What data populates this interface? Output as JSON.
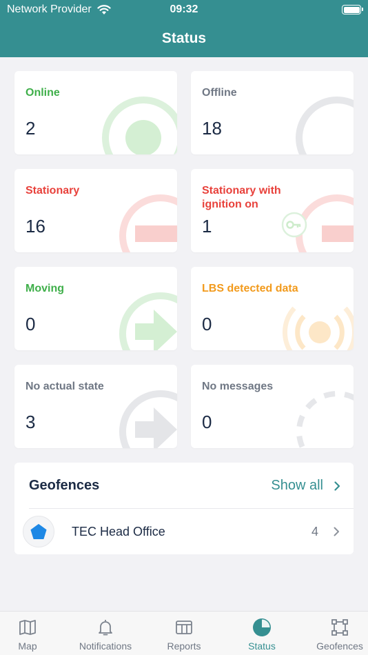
{
  "status_bar": {
    "carrier": "Network Provider",
    "time": "09:32"
  },
  "header": {
    "title": "Status"
  },
  "cards": {
    "online": {
      "label": "Online",
      "count": "2",
      "color": "#3faf4a"
    },
    "offline": {
      "label": "Offline",
      "count": "18",
      "color": "#6f7784"
    },
    "stationary": {
      "label": "Stationary",
      "count": "16",
      "color": "#e8413b"
    },
    "stationary_ignition": {
      "label": "Stationary with ignition on",
      "count": "1",
      "color": "#e8413b"
    },
    "moving": {
      "label": "Moving",
      "count": "0",
      "color": "#3faf4a"
    },
    "lbs": {
      "label": "LBS detected data",
      "count": "0",
      "color": "#f29a1c"
    },
    "no_state": {
      "label": "No actual state",
      "count": "3",
      "color": "#6f7784"
    },
    "no_messages": {
      "label": "No messages",
      "count": "0",
      "color": "#6f7784"
    }
  },
  "geofences": {
    "title": "Geofences",
    "show_all": "Show all",
    "items": [
      {
        "name": "TEC Head Office",
        "count": "4",
        "icon": "pentagon-icon"
      }
    ]
  },
  "tabbar": {
    "tabs": [
      {
        "label": "Map",
        "icon": "map-icon",
        "active": false
      },
      {
        "label": "Notifications",
        "icon": "bell-icon",
        "active": false
      },
      {
        "label": "Reports",
        "icon": "table-icon",
        "active": false
      },
      {
        "label": "Status",
        "icon": "pie-icon",
        "active": true
      },
      {
        "label": "Geofences",
        "icon": "geofence-icon",
        "active": false
      }
    ]
  },
  "colors": {
    "accent": "#358f91",
    "background": "#f2f2f5"
  }
}
